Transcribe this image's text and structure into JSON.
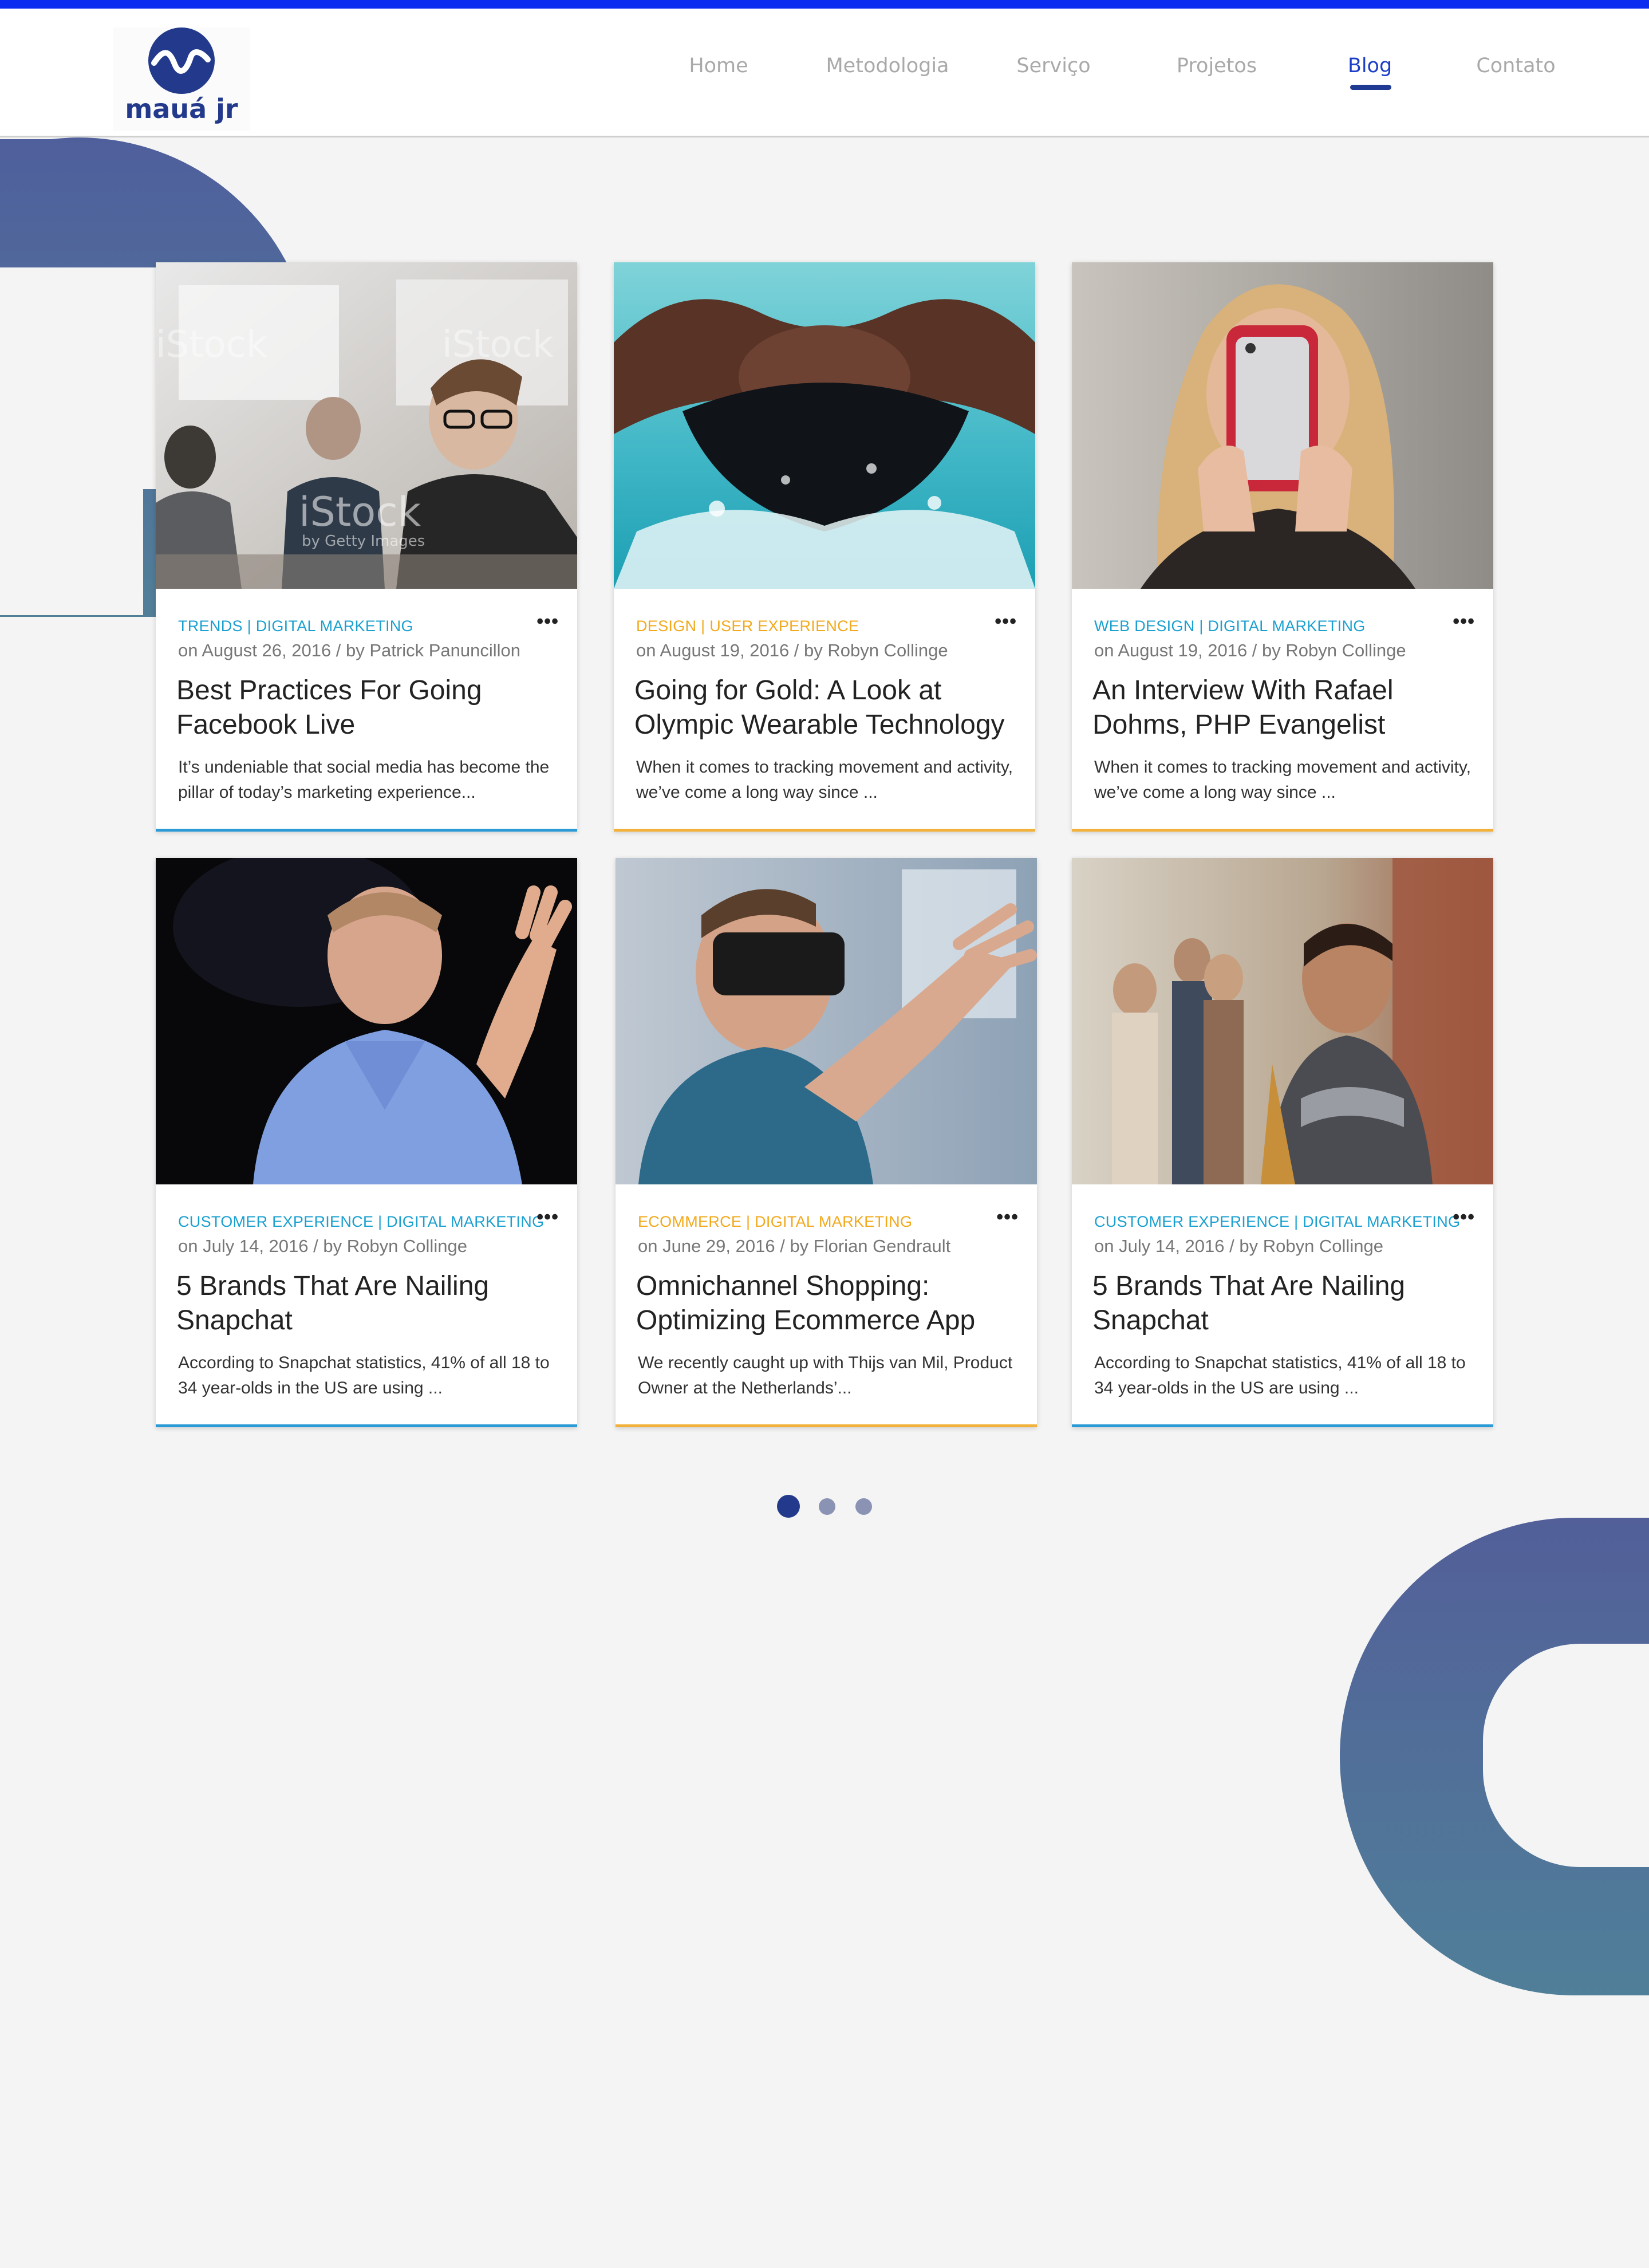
{
  "colors": {
    "brand": "#1f3a93",
    "nav_active": "#1d3ec7",
    "top_strip": "#0c2cf0",
    "category_blue": "#1ba0d0",
    "category_orange": "#f2a91c",
    "accent_blue": "#2a9bd6",
    "accent_orange": "#f2b13a"
  },
  "logo": {
    "text": "mauá jr",
    "icon": "wave-logo-icon"
  },
  "nav": {
    "items": [
      {
        "label": "Home"
      },
      {
        "label": "Metodologia"
      },
      {
        "label": "Serviço"
      },
      {
        "label": "Projetos"
      },
      {
        "label": "Blog",
        "active": true
      },
      {
        "label": "Contato"
      }
    ]
  },
  "posts": [
    {
      "category": "TRENDS | DIGITAL MARKETING",
      "meta": "on August 26, 2016 / by Patrick Panuncillon",
      "title": "Best Practices For Going Facebook Live",
      "excerpt": "It’s undeniable that social media has become the pillar of today’s marketing experience...",
      "image": "students-studying-photo",
      "watermark": "iStock",
      "watermark_sub": "by Getty Images",
      "color_key": "blue"
    },
    {
      "category": "DESIGN | USER EXPERIENCE",
      "meta": "on August 19, 2016 / by Robyn Collinge",
      "title": "Going for Gold: A Look at Olympic Wearable Technology",
      "excerpt": "When it comes to tracking movement and activity, we’ve come a long way since ...",
      "image": "swimmer-splash-photo",
      "color_key": "orange"
    },
    {
      "category": "WEB DESIGN | DIGITAL MARKETING",
      "meta": "on August 19, 2016 / by Robyn Collinge",
      "title": "An Interview With Rafael Dohms, PHP Evangelist",
      "excerpt": "When it comes to tracking movement and activity, we’ve come a long way since ...",
      "image": "woman-with-phone-photo",
      "color_key": "orange"
    },
    {
      "category": "CUSTOMER EXPERIENCE | DIGITAL MARKETING",
      "meta": "on July 14, 2016 / by Robyn Collinge",
      "title": "5 Brands That Are Nailing Snapchat",
      "excerpt": "According to Snapchat statistics, 41% of all 18 to 34 year-olds in the US are using ...",
      "image": "speaker-on-stage-photo",
      "color_key": "blue"
    },
    {
      "category": "ECOMMERCE | DIGITAL MARKETING",
      "meta": "on June 29, 2016 / by Florian Gendrault",
      "title": "Omnichannel Shopping: Optimizing Ecommerce App",
      "excerpt": "We recently caught up with Thijs van Mil, Product Owner at the Netherlands’...",
      "image": "vr-headset-photo",
      "color_key": "orange"
    },
    {
      "category": "CUSTOMER EXPERIENCE | DIGITAL MARKETING",
      "meta": "on July 14, 2016 / by Robyn Collinge",
      "title": "5 Brands That Are Nailing Snapchat",
      "excerpt": "According to Snapchat statistics, 41% of all 18 to 34 year-olds in the US are using ...",
      "image": "student-in-hallway-photo",
      "color_key": "blue"
    }
  ],
  "more_label": "•••",
  "pagination": {
    "pages": 3,
    "current": 1
  }
}
